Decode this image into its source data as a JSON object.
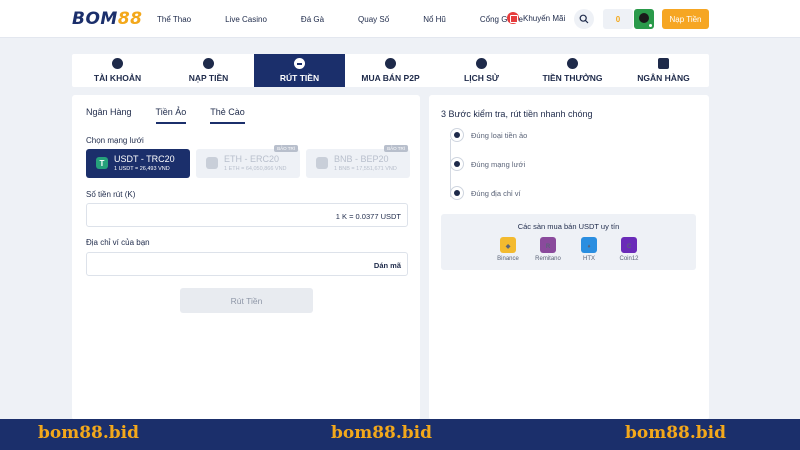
{
  "header": {
    "logo_text": "BOM",
    "logo_num": "88",
    "nav": [
      "Thể Thao",
      "Live Casino",
      "Đá Gà",
      "Quay Số",
      "Nổ Hũ",
      "Cổng Game"
    ],
    "promo_label": "Khuyến Mãi",
    "balance": "0",
    "deposit_label": "Nạp Tiền"
  },
  "tabs": [
    {
      "label": "TÀI KHOẢN"
    },
    {
      "label": "NẠP TIỀN"
    },
    {
      "label": "RÚT TIỀN"
    },
    {
      "label": "MUA BÁN P2P"
    },
    {
      "label": "LỊCH SỬ"
    },
    {
      "label": "TIỀN THƯỞNG"
    },
    {
      "label": "NGÂN HÀNG"
    }
  ],
  "withdraw": {
    "subtabs": [
      "Ngân Hàng",
      "Tiền Ảo",
      "Thẻ Cào"
    ],
    "network_label": "Chọn mạng lưới",
    "networks": [
      {
        "name": "USDT - TRC20",
        "rate": "1 USDT = 26,493 VND",
        "badge": "T",
        "tag": ""
      },
      {
        "name": "ETH - ERC20",
        "rate": "1 ETH = 64,050,866 VND",
        "badge": "",
        "tag": "BẢO TRÌ"
      },
      {
        "name": "BNB - BEP20",
        "rate": "1 BNB = 17,551,671 VND",
        "badge": "",
        "tag": "BẢO TRÌ"
      }
    ],
    "amount_label": "Số tiền rút (K)",
    "amount_hint": "1 K = 0.0377 USDT",
    "address_label": "Địa chỉ ví của bạn",
    "paste_label": "Dán mã",
    "submit_label": "Rút Tiền"
  },
  "guide": {
    "title": "3 Bước kiểm tra, rút tiền nhanh chóng",
    "steps": [
      "Đúng loại tiền ảo",
      "Đúng mạng lưới",
      "Đúng địa chỉ ví"
    ],
    "exchanges_title": "Các sàn mua bán USDT uy tín",
    "exchanges": [
      {
        "name": "Binance",
        "color": "#f3ba2f",
        "glyph": "◆"
      },
      {
        "name": "Remitano",
        "color": "#8a4a9c",
        "glyph": "R"
      },
      {
        "name": "HTX",
        "color": "#2a8ee0",
        "glyph": "♦"
      },
      {
        "name": "Coin12",
        "color": "#6a2bb8",
        "glyph": "C"
      }
    ]
  },
  "footer": {
    "watermarks": [
      "bom88.bid",
      "bom88.bid",
      "bom88.bid"
    ]
  }
}
